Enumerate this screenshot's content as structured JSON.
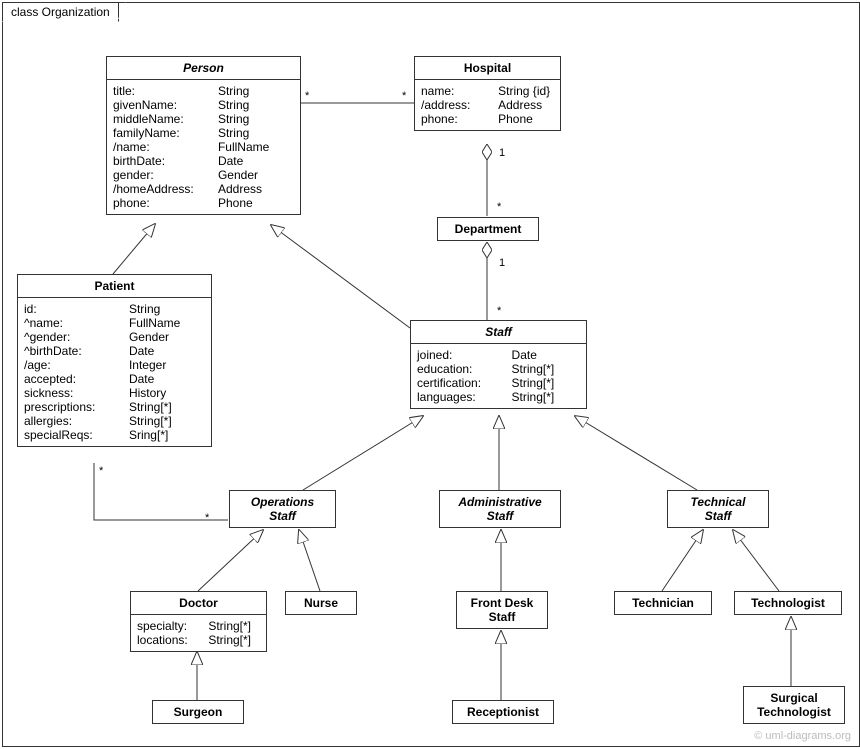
{
  "frameTitle": "class Organization",
  "watermark": "© uml-diagrams.org",
  "classes": {
    "person": {
      "name": "Person",
      "attrs": [
        {
          "k": "title:",
          "v": "String"
        },
        {
          "k": "givenName:",
          "v": "String"
        },
        {
          "k": "middleName:",
          "v": "String"
        },
        {
          "k": "familyName:",
          "v": "String"
        },
        {
          "k": "/name:",
          "v": "FullName"
        },
        {
          "k": "birthDate:",
          "v": "Date"
        },
        {
          "k": "gender:",
          "v": "Gender"
        },
        {
          "k": "/homeAddress:",
          "v": "Address"
        },
        {
          "k": "phone:",
          "v": "Phone"
        }
      ]
    },
    "hospital": {
      "name": "Hospital",
      "attrs": [
        {
          "k": "name:",
          "v": "String {id}"
        },
        {
          "k": "/address:",
          "v": "Address"
        },
        {
          "k": "phone:",
          "v": "Phone"
        }
      ]
    },
    "department": {
      "name": "Department"
    },
    "patient": {
      "name": "Patient",
      "attrs": [
        {
          "k": "id:",
          "v": "String"
        },
        {
          "k": "^name:",
          "v": "FullName"
        },
        {
          "k": "^gender:",
          "v": "Gender"
        },
        {
          "k": "^birthDate:",
          "v": "Date"
        },
        {
          "k": "/age:",
          "v": "Integer"
        },
        {
          "k": "accepted:",
          "v": "Date"
        },
        {
          "k": "sickness:",
          "v": "History"
        },
        {
          "k": "prescriptions:",
          "v": "String[*]"
        },
        {
          "k": "allergies:",
          "v": "String[*]"
        },
        {
          "k": "specialReqs:",
          "v": "Sring[*]"
        }
      ]
    },
    "staff": {
      "name": "Staff",
      "attrs": [
        {
          "k": "joined:",
          "v": "Date"
        },
        {
          "k": "education:",
          "v": "String[*]"
        },
        {
          "k": "certification:",
          "v": "String[*]"
        },
        {
          "k": "languages:",
          "v": "String[*]"
        }
      ]
    },
    "opsStaff": {
      "name": "Operations",
      "name2": "Staff"
    },
    "adminStaff": {
      "name": "Administrative",
      "name2": "Staff"
    },
    "techStaff": {
      "name": "Technical",
      "name2": "Staff"
    },
    "doctor": {
      "name": "Doctor",
      "attrs": [
        {
          "k": "specialty:",
          "v": "String[*]"
        },
        {
          "k": "locations:",
          "v": "String[*]"
        }
      ]
    },
    "nurse": {
      "name": "Nurse"
    },
    "frontDesk": {
      "name": "Front Desk",
      "name2": "Staff"
    },
    "technician": {
      "name": "Technician"
    },
    "technologist": {
      "name": "Technologist"
    },
    "surgeon": {
      "name": "Surgeon"
    },
    "receptionist": {
      "name": "Receptionist"
    },
    "surgTech": {
      "name": "Surgical",
      "name2": "Technologist"
    }
  },
  "mults": {
    "personHospL": "*",
    "personHospR": "*",
    "hospDeptTop": "1",
    "hospDeptBot": "*",
    "deptStaffTop": "1",
    "deptStaffBot": "*",
    "patientOpsTop": "*",
    "patientOpsBot": "*"
  }
}
